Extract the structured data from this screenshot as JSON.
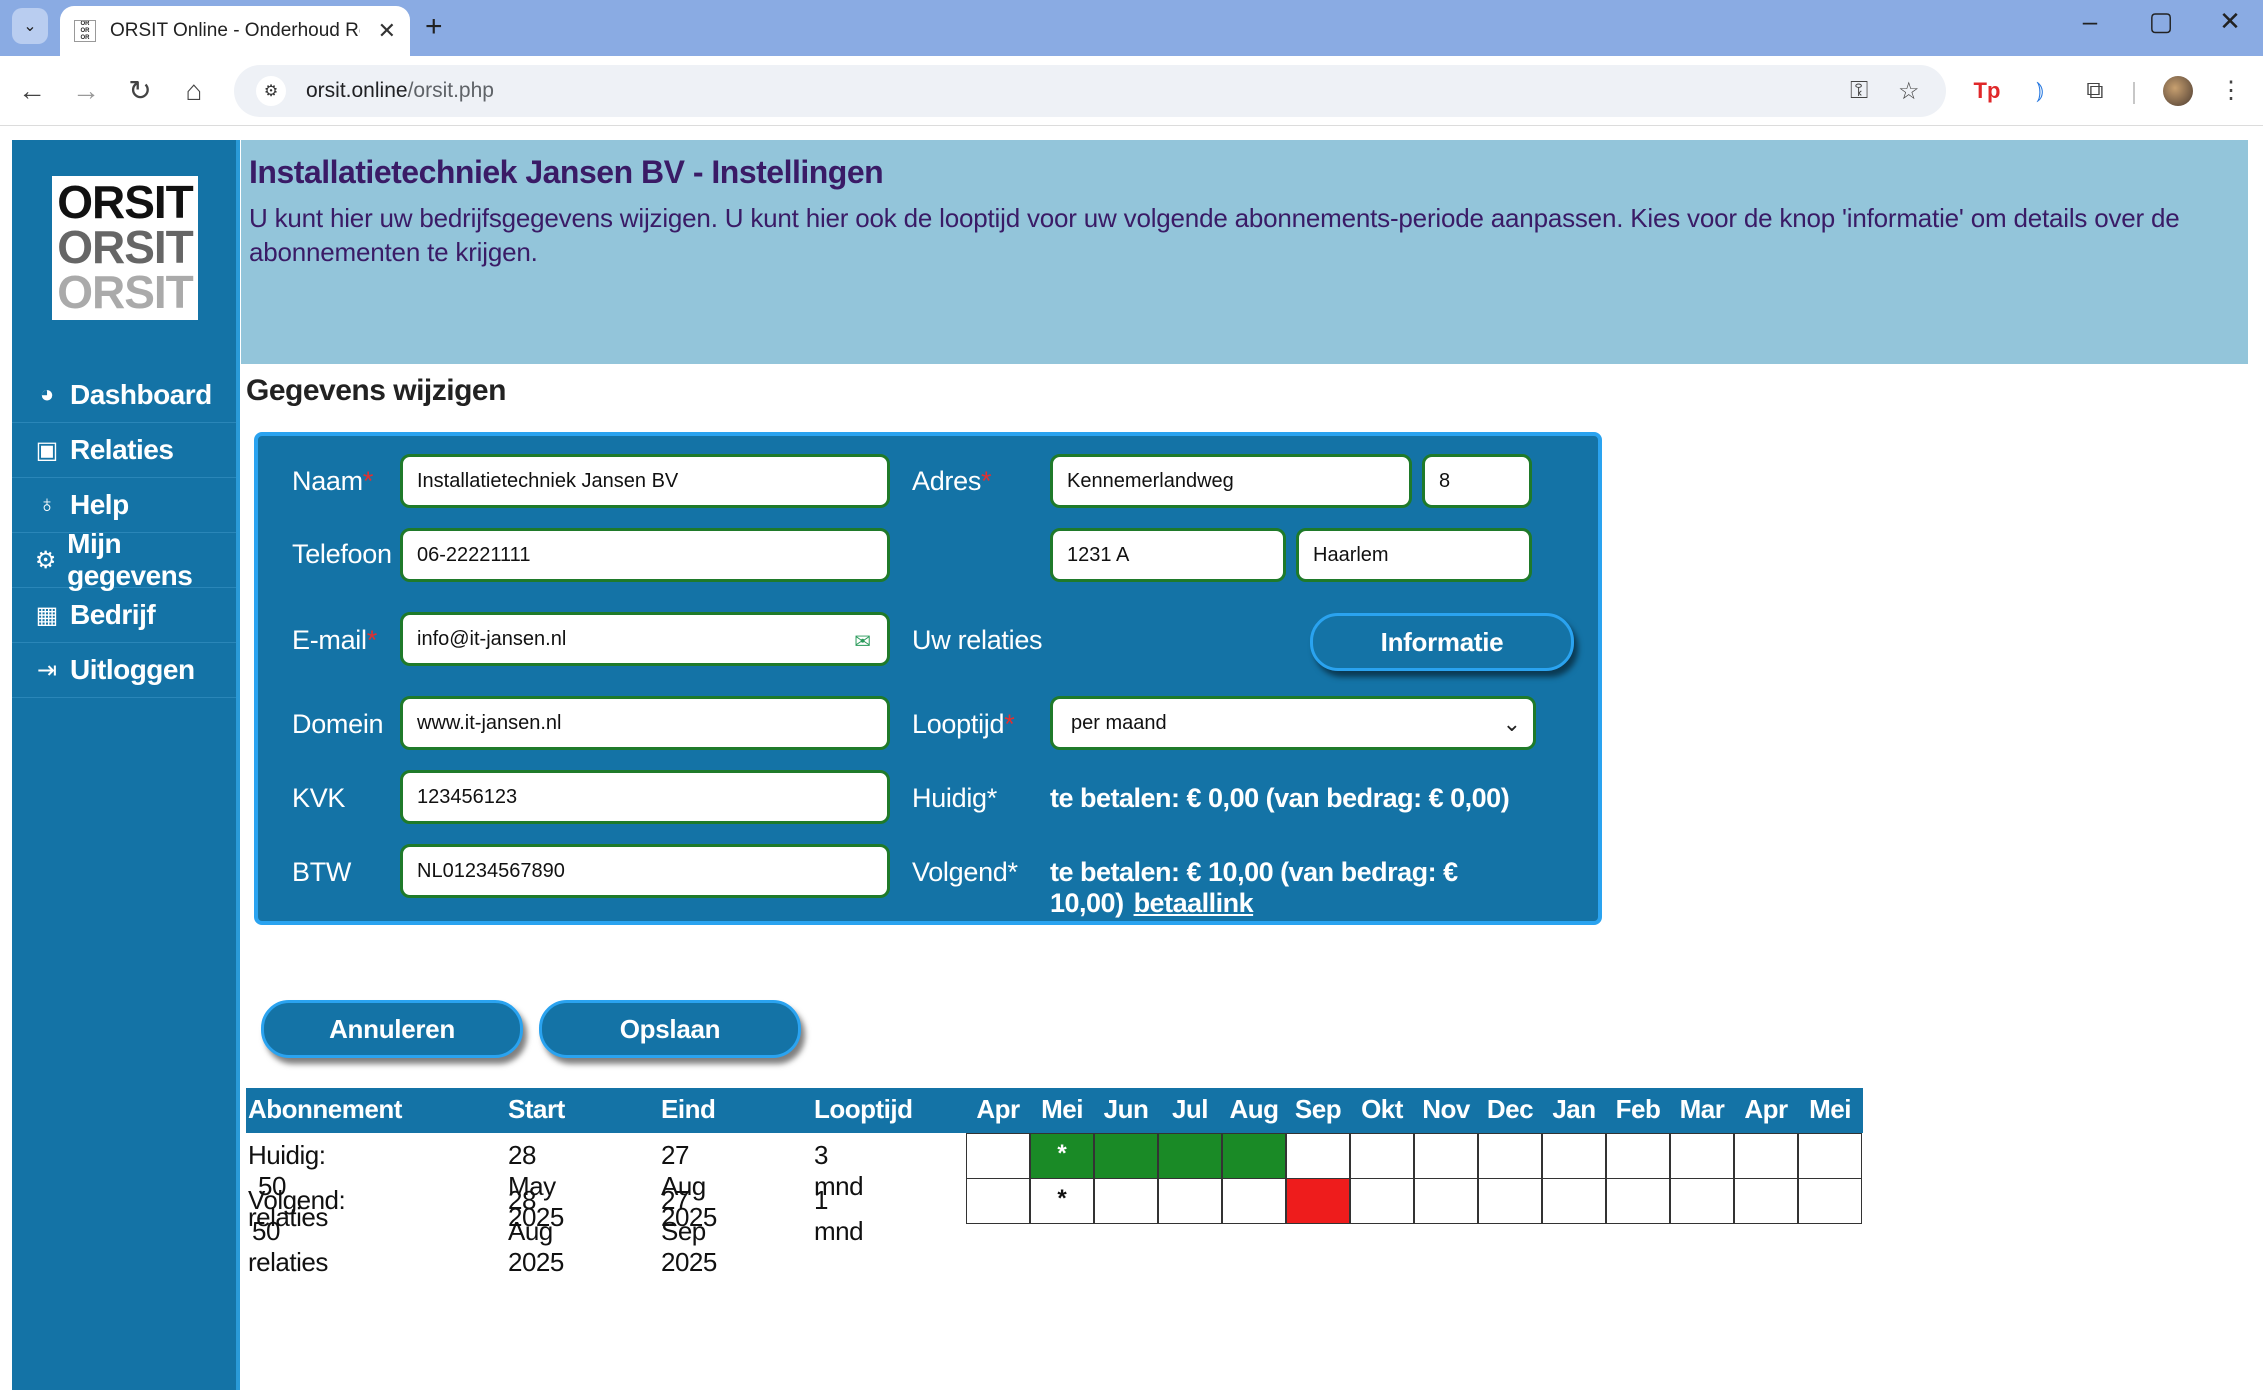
{
  "browser": {
    "tab_title": "ORSIT Online - Onderhoud Reg",
    "url_host": "orsit.online",
    "url_path": "/orsit.php",
    "tab_close": "✕",
    "new_tab": "+"
  },
  "sidebar": {
    "logo_lines": [
      "ORSIT",
      "ORSIT",
      "ORSIT"
    ],
    "items": [
      {
        "label": "Dashboard",
        "icon": "dashboard-icon"
      },
      {
        "label": "Relaties",
        "icon": "contact-card-icon"
      },
      {
        "label": "Help",
        "icon": "lightbulb-icon"
      },
      {
        "label": "Mijn gegevens",
        "icon": "gears-icon"
      },
      {
        "label": "Bedrijf",
        "icon": "building-icon"
      },
      {
        "label": "Uitloggen",
        "icon": "sign-out-icon"
      }
    ]
  },
  "header": {
    "title": "Installatietechniek Jansen BV - Instellingen",
    "description": "U kunt hier uw bedrijfsgegevens wijzigen. U kunt hier ook de looptijd voor uw volgende abonnements-periode aanpassen. Kies voor de knop 'informatie' om details over de abonnementen te krijgen."
  },
  "form": {
    "section_title": "Gegevens wijzigen",
    "labels": {
      "naam": "Naam",
      "telefoon": "Telefoon",
      "email": "E-mail",
      "domein": "Domein",
      "kvk": "KVK",
      "btw": "BTW",
      "adres": "Adres",
      "uw_relaties": "Uw relaties",
      "looptijd": "Looptijd",
      "huidig": "Huidig*",
      "volgend": "Volgend*",
      "required_mark": "*"
    },
    "values": {
      "naam": "Installatietechniek Jansen BV",
      "telefoon": "06-22221111",
      "email": "info@it-jansen.nl",
      "domein": "www.it-jansen.nl",
      "kvk": "123456123",
      "btw": "NL01234567890",
      "straat": "Kennemerlandweg",
      "huisnummer": "8",
      "postcode": "1231 A",
      "plaats": "Haarlem",
      "looptijd": "per maand",
      "huidig_text": "te betalen: € 0,00 (van bedrag: € 0,00)",
      "volgend_text": "te betalen: € 10,00 (van bedrag: € 10,00)",
      "betaallink": "betaallink"
    },
    "informatie_button": "Informatie",
    "cancel_button": "Annuleren",
    "save_button": "Opslaan"
  },
  "subscriptions": {
    "headers": [
      "Abonnement",
      "Start",
      "Eind",
      "Looptijd"
    ],
    "months": [
      "Apr",
      "Mei",
      "Jun",
      "Jul",
      "Aug",
      "Sep",
      "Okt",
      "Nov",
      "Dec",
      "Jan",
      "Feb",
      "Mar",
      "Apr",
      "Mei"
    ],
    "rows": [
      {
        "label": "Huidig:",
        "relaties": "50 relaties",
        "start": "28 May 2025",
        "end": "27 Aug 2025",
        "duration": "3 mnd",
        "cells": [
          "",
          "*",
          "",
          "",
          "",
          "",
          "",
          "",
          "",
          "",
          "",
          "",
          "",
          ""
        ],
        "cell_colors": [
          "",
          "#1a8a26",
          "#1a8a26",
          "#1a8a26",
          "#1a8a26",
          "",
          "",
          "",
          "",
          "",
          "",
          "",
          "",
          ""
        ]
      },
      {
        "label": "Volgend:",
        "relaties": "50 relaties",
        "start": "28 Aug 2025",
        "end": "27 Sep 2025",
        "duration": "1 mnd",
        "cells": [
          "",
          "*",
          "",
          "",
          "",
          "",
          "",
          "",
          "",
          "",
          "",
          "",
          "",
          ""
        ],
        "cell_colors": [
          "",
          "",
          "",
          "",
          "",
          "#ee1c1c",
          "",
          "",
          "",
          "",
          "",
          "",
          "",
          ""
        ]
      }
    ]
  },
  "colors": {
    "brand_blue": "#1473a6",
    "header_bg": "#93c5da",
    "header_text": "#3a1b66",
    "active_green": "#1a8a26",
    "next_red": "#ee1c1c"
  }
}
